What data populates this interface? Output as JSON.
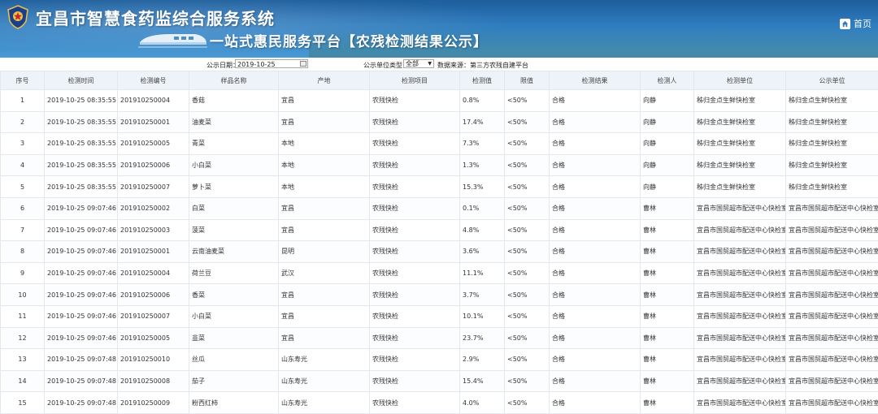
{
  "header": {
    "system_title": "宜昌市智慧食药监综合服务系统",
    "platform_title": "一站式惠民服务平台【农残检测结果公示】",
    "home_label": "首页"
  },
  "filters": {
    "date_label": "公示日期：",
    "date_value": "2019-10-25",
    "type_label": "公示单位类型：",
    "type_value": "全部",
    "source_text": "数据来源：第三方农残自建平台"
  },
  "columns": [
    "序号",
    "检测时间",
    "检测编号",
    "样品名称",
    "产地",
    "检测项目",
    "检测值",
    "限值",
    "检测结果",
    "检测人",
    "检测单位",
    "公示单位"
  ],
  "rows": [
    [
      "1",
      "2019-10-25 08:35:55",
      "201910250004",
      "香菇",
      "宜昌",
      "农残快检",
      "0.8%",
      "<50%",
      "合格",
      "向静",
      "秭归金点生鲜快检室",
      "秭归金点生鲜快检室"
    ],
    [
      "2",
      "2019-10-25 08:35:55",
      "201910250001",
      "油麦菜",
      "宜昌",
      "农残快检",
      "17.4%",
      "<50%",
      "合格",
      "向静",
      "秭归金点生鲜快检室",
      "秭归金点生鲜快检室"
    ],
    [
      "3",
      "2019-10-25 08:35:55",
      "201910250005",
      "青菜",
      "本地",
      "农残快检",
      "7.3%",
      "<50%",
      "合格",
      "向静",
      "秭归金点生鲜快检室",
      "秭归金点生鲜快检室"
    ],
    [
      "4",
      "2019-10-25 08:35:55",
      "201910250006",
      "小白菜",
      "本地",
      "农残快检",
      "1.3%",
      "<50%",
      "合格",
      "向静",
      "秭归金点生鲜快检室",
      "秭归金点生鲜快检室"
    ],
    [
      "5",
      "2019-10-25 08:35:55",
      "201910250007",
      "萝卜菜",
      "本地",
      "农残快检",
      "15.3%",
      "<50%",
      "合格",
      "向静",
      "秭归金点生鲜快检室",
      "秭归金点生鲜快检室"
    ],
    [
      "6",
      "2019-10-25 09:07:46",
      "201910250002",
      "白菜",
      "宜昌",
      "农残快检",
      "0.1%",
      "<50%",
      "合格",
      "曹林",
      "宜昌市国贸超市配送中心快检室",
      "宜昌市国贸超市配送中心快检室"
    ],
    [
      "7",
      "2019-10-25 09:07:46",
      "201910250003",
      "菠菜",
      "宜昌",
      "农残快检",
      "4.8%",
      "<50%",
      "合格",
      "曹林",
      "宜昌市国贸超市配送中心快检室",
      "宜昌市国贸超市配送中心快检室"
    ],
    [
      "8",
      "2019-10-25 09:07:46",
      "201910250001",
      "云南油麦菜",
      "昆明",
      "农残快检",
      "3.6%",
      "<50%",
      "合格",
      "曹林",
      "宜昌市国贸超市配送中心快检室",
      "宜昌市国贸超市配送中心快检室"
    ],
    [
      "9",
      "2019-10-25 09:07:46",
      "201910250004",
      "荷兰豆",
      "武汉",
      "农残快检",
      "11.1%",
      "<50%",
      "合格",
      "曹林",
      "宜昌市国贸超市配送中心快检室",
      "宜昌市国贸超市配送中心快检室"
    ],
    [
      "10",
      "2019-10-25 09:07:46",
      "201910250006",
      "香菜",
      "宜昌",
      "农残快检",
      "3.7%",
      "<50%",
      "合格",
      "曹林",
      "宜昌市国贸超市配送中心快检室",
      "宜昌市国贸超市配送中心快检室"
    ],
    [
      "11",
      "2019-10-25 09:07:46",
      "201910250007",
      "小白菜",
      "宜昌",
      "农残快检",
      "10.1%",
      "<50%",
      "合格",
      "曹林",
      "宜昌市国贸超市配送中心快检室",
      "宜昌市国贸超市配送中心快检室"
    ],
    [
      "12",
      "2019-10-25 09:07:46",
      "201910250005",
      "韭菜",
      "宜昌",
      "农残快检",
      "23.7%",
      "<50%",
      "合格",
      "曹林",
      "宜昌市国贸超市配送中心快检室",
      "宜昌市国贸超市配送中心快检室"
    ],
    [
      "13",
      "2019-10-25 09:07:48",
      "201910250010",
      "丝瓜",
      "山东寿光",
      "农残快检",
      "2.9%",
      "<50%",
      "合格",
      "曹林",
      "宜昌市国贸超市配送中心快检室",
      "宜昌市国贸超市配送中心快检室"
    ],
    [
      "14",
      "2019-10-25 09:07:48",
      "201910250008",
      "茄子",
      "山东寿光",
      "农残快检",
      "15.4%",
      "<50%",
      "合格",
      "曹林",
      "宜昌市国贸超市配送中心快检室",
      "宜昌市国贸超市配送中心快检室"
    ],
    [
      "15",
      "2019-10-25 09:07:48",
      "201910250009",
      "粉西红柿",
      "山东寿光",
      "农残快检",
      "4.0%",
      "<50%",
      "合格",
      "曹林",
      "宜昌市国贸超市配送中心快检室",
      "宜昌市国贸超市配送中心快检室"
    ]
  ]
}
